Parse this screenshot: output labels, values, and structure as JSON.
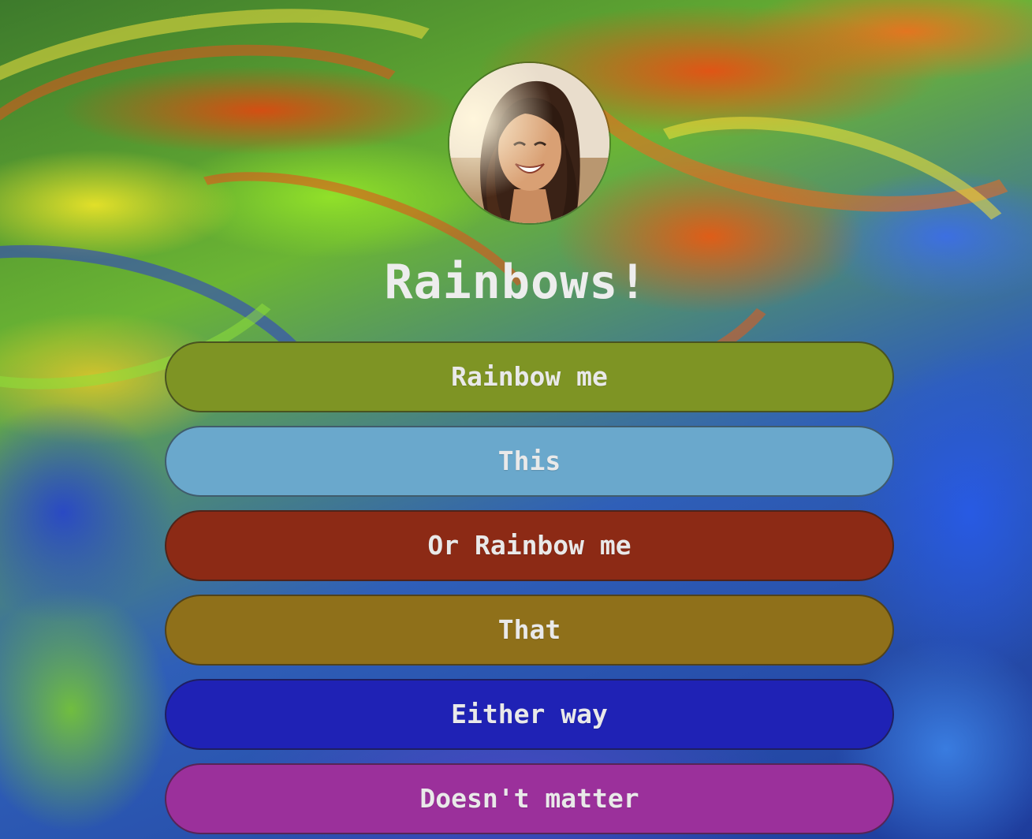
{
  "page": {
    "title": "Rainbows!"
  },
  "profile": {
    "image_name": "profile-photo-woman-smiling"
  },
  "links": [
    {
      "label": "Rainbow me",
      "color": "#7e9424"
    },
    {
      "label": "This",
      "color": "#6aa8cc"
    },
    {
      "label": "Or Rainbow me",
      "color": "#8c2a15"
    },
    {
      "label": "That",
      "color": "#8f701a"
    },
    {
      "label": "Either way",
      "color": "#1f22b5"
    },
    {
      "label": "Doesn't matter",
      "color": "#9b309b"
    }
  ]
}
